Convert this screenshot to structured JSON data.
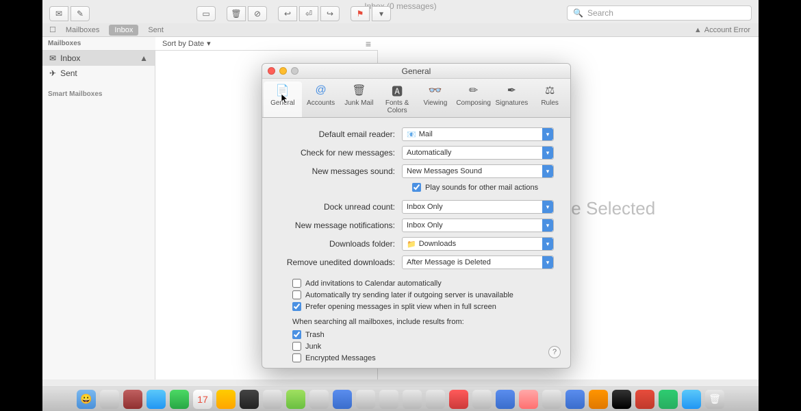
{
  "window": {
    "title": "Inbox (0 messages)"
  },
  "search": {
    "placeholder": "Search"
  },
  "favbar": {
    "mailboxes": "Mailboxes",
    "inbox": "Inbox",
    "sent": "Sent",
    "error": "Account Error"
  },
  "sidebar": {
    "title": "Mailboxes",
    "inbox": "Inbox",
    "sent": "Sent",
    "smart": "Smart Mailboxes"
  },
  "list": {
    "sort": "Sort by Date"
  },
  "preview": {
    "text": "No Message Selected"
  },
  "prefs": {
    "title": "General",
    "tabs": {
      "general": "General",
      "accounts": "Accounts",
      "junk": "Junk Mail",
      "fonts": "Fonts & Colors",
      "viewing": "Viewing",
      "composing": "Composing",
      "signatures": "Signatures",
      "rules": "Rules"
    },
    "rows": {
      "reader_label": "Default email reader:",
      "reader_value": "Mail",
      "check_label": "Check for new messages:",
      "check_value": "Automatically",
      "sound_label": "New messages sound:",
      "sound_value": "New Messages Sound",
      "play_label": "Play sounds for other mail actions",
      "dock_label": "Dock unread count:",
      "dock_value": "Inbox Only",
      "notif_label": "New message notifications:",
      "notif_value": "Inbox Only",
      "downloads_label": "Downloads folder:",
      "downloads_value": "Downloads",
      "remove_label": "Remove unedited downloads:",
      "remove_value": "After Message is Deleted",
      "cal_label": "Add invitations to Calendar automatically",
      "auto_label": "Automatically try sending later if outgoing server is unavailable",
      "split_label": "Prefer opening messages in split view when in full screen",
      "search_label": "When searching all mailboxes, include results from:",
      "trash_label": "Trash",
      "junk_label": "Junk",
      "enc_label": "Encrypted Messages"
    }
  }
}
